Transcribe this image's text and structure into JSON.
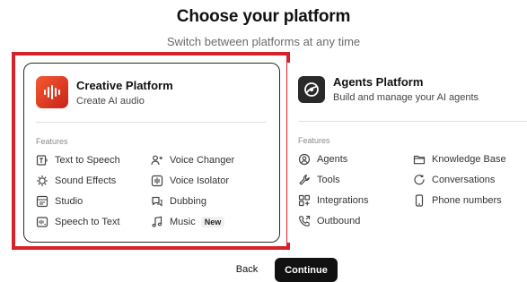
{
  "header": {
    "title": "Choose your platform",
    "subtitle": "Switch between platforms at any time"
  },
  "colors": {
    "highlight": "#d6222a",
    "creative_logo": "#e8402a",
    "agents_logo": "#2a2a2a",
    "primary_button": "#111111"
  },
  "creative": {
    "title": "Creative Platform",
    "desc": "Create AI audio",
    "selected": true,
    "features_label": "Features",
    "features": [
      {
        "label": "Text to Speech",
        "icon": "text-to-speech-icon"
      },
      {
        "label": "Voice Changer",
        "icon": "voice-changer-icon"
      },
      {
        "label": "Sound Effects",
        "icon": "sound-effects-icon"
      },
      {
        "label": "Voice Isolator",
        "icon": "voice-isolator-icon"
      },
      {
        "label": "Studio",
        "icon": "studio-icon"
      },
      {
        "label": "Dubbing",
        "icon": "dubbing-icon"
      },
      {
        "label": "Speech to Text",
        "icon": "speech-to-text-icon"
      },
      {
        "label": "Music",
        "icon": "music-icon",
        "badge": "New"
      }
    ]
  },
  "agents": {
    "title": "Agents Platform",
    "desc": "Build and manage your AI agents",
    "features_label": "Features",
    "features": [
      {
        "label": "Agents",
        "icon": "agents-icon"
      },
      {
        "label": "Knowledge Base",
        "icon": "knowledge-base-icon"
      },
      {
        "label": "Tools",
        "icon": "tools-icon"
      },
      {
        "label": "Conversations",
        "icon": "conversations-icon"
      },
      {
        "label": "Integrations",
        "icon": "integrations-icon"
      },
      {
        "label": "Phone numbers",
        "icon": "phone-numbers-icon"
      },
      {
        "label": "Outbound",
        "icon": "outbound-icon"
      }
    ]
  },
  "actions": {
    "back": "Back",
    "continue": "Continue"
  }
}
